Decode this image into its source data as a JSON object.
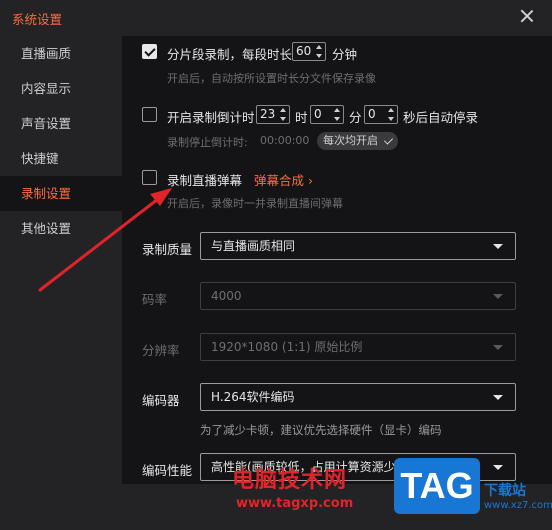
{
  "window": {
    "title": "系统设置"
  },
  "sidebar": {
    "items": [
      {
        "label": "直播画质",
        "active": false
      },
      {
        "label": "内容显示",
        "active": false
      },
      {
        "label": "声音设置",
        "active": false
      },
      {
        "label": "快捷键",
        "active": false
      },
      {
        "label": "录制设置",
        "active": true
      },
      {
        "label": "其他设置",
        "active": false
      }
    ]
  },
  "segment": {
    "checked": true,
    "label_before": "分片段录制，每段时长",
    "minutes": "60",
    "label_after": "分钟",
    "hint": "开启后，自动按所设置时长分文件保存录像"
  },
  "countdown": {
    "checked": false,
    "label_before": "开启录制倒计时",
    "hours": "23",
    "hours_unit": "时",
    "minutes": "0",
    "minutes_unit": "分",
    "seconds": "0",
    "label_after": "秒后自动停录",
    "status_label": "录制停止倒计时:",
    "status_time": "00:00:00",
    "every_time_label": "每次均开启"
  },
  "danmaku": {
    "checked": false,
    "label": "录制直播弹幕",
    "link_label": "弹幕合成 ›",
    "hint": "开启后，录像时一并录制直播间弹幕"
  },
  "quality": {
    "label": "录制质量",
    "value": "与直播画质相同"
  },
  "bitrate": {
    "label": "码率",
    "value": "4000"
  },
  "resolution": {
    "label": "分辨率",
    "value": "1920*1080 (1:1) 原始比例"
  },
  "encoder": {
    "label": "编码器",
    "value": "H.264软件编码",
    "hint": "为了减少卡顿，建议优先选择硬件（显卡）编码"
  },
  "performance": {
    "label": "编码性能",
    "value": "高性能(画质较低，占用计算资源少)"
  },
  "watermark": {
    "site_name": "电脑技术网",
    "url": "www.tagxp.com",
    "logo": "TAG",
    "side_text": "下载站",
    "side_url": "www.xz7.com"
  },
  "colors": {
    "accent": "#ff6a3d",
    "annotation_arrow": "#e0242a",
    "logo_blue": "#1877d4"
  }
}
